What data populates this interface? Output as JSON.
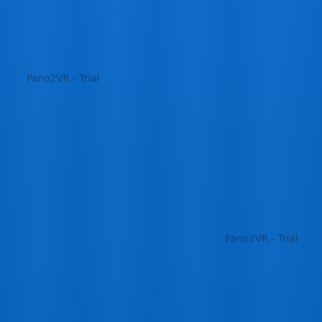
{
  "viewer": {
    "background_color": "#0a66c2",
    "watermark_text_1": "Pano2VR - Trial",
    "watermark_text_2": "Pano2VR - Trial",
    "watermark_color": "#14375f"
  }
}
